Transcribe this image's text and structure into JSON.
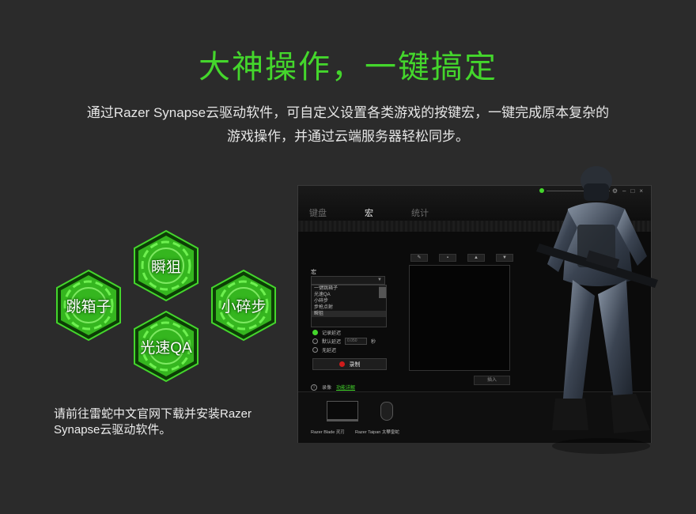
{
  "headline": "大神操作，一键搞定",
  "subtitle": {
    "line1": "通过Razer Synapse云驱动软件，可自定义设置各类游戏的按键宏，一键完成原本复杂的",
    "line2": "游戏操作，并通过云端服务器轻松同步。"
  },
  "hexes": [
    {
      "label": "瞬狙"
    },
    {
      "label": "跳箱子"
    },
    {
      "label": "小碎步"
    },
    {
      "label": "光速QA"
    }
  ],
  "download_note": "请前往雷蛇中文官网下载并安装Razer Synapse云驱动软件。",
  "colors": {
    "accent": "#44d62c",
    "background": "#2b2b2b",
    "record": "#d01c1c"
  },
  "app": {
    "tabs": [
      {
        "label": "键盘",
        "active": false
      },
      {
        "label": "宏",
        "active": true
      },
      {
        "label": "统计",
        "active": false
      }
    ],
    "window_controls": [
      "gear-icon",
      "minimize-icon",
      "maximize-icon",
      "close-icon"
    ],
    "macro_label": "宏",
    "macro_list": [
      "一键跳箱子",
      "光速QA",
      "小碎步",
      "步枪点射",
      "瞬狙"
    ],
    "macro_selected_index": 4,
    "options": [
      {
        "label": "记录延迟",
        "selected": true
      },
      {
        "label": "默认延迟",
        "selected": false,
        "value": "0.050",
        "unit": "秒"
      },
      {
        "label": "无延迟",
        "selected": false
      }
    ],
    "record_label": "录制",
    "toolbar_icons": [
      "edit-icon",
      "delete-icon",
      "move-up-icon",
      "move-down-icon"
    ],
    "insert_label": "插入",
    "hint_label": "录像",
    "hint_link": "功能详解",
    "devices": [
      {
        "name": "Razer Blade 灵刃"
      },
      {
        "name": "Razer Taipan 太攀皇蛇"
      }
    ]
  }
}
